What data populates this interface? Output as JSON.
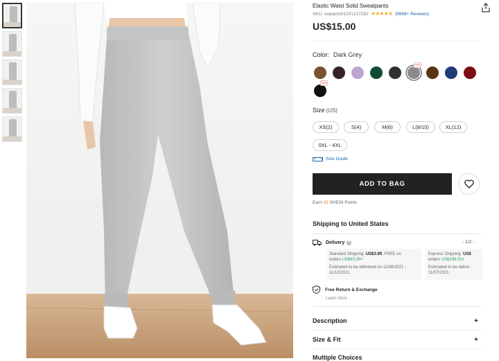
{
  "product": {
    "title": "Elastic Waist Solid Sweatpants",
    "sku": "SKU: swpants01201217292",
    "stars": "★★★★★",
    "reviews": "(9999+ Reviews)",
    "price": "US$15.00"
  },
  "color": {
    "label": "Color:",
    "selected": "Dark Grey",
    "swatches": [
      {
        "name": "brown",
        "hex": "#7a5230"
      },
      {
        "name": "dark-burgundy",
        "hex": "#3a2328"
      },
      {
        "name": "lilac",
        "hex": "#bba5cf"
      },
      {
        "name": "dark-green",
        "hex": "#0f4d33"
      },
      {
        "name": "charcoal",
        "hex": "#2f3033"
      },
      {
        "name": "dark-grey",
        "hex": "#8a8a8a",
        "selected": true,
        "badge": "Hot"
      },
      {
        "name": "coffee",
        "hex": "#5a3614"
      },
      {
        "name": "navy",
        "hex": "#1f3b7a"
      },
      {
        "name": "burgundy",
        "hex": "#7a0f14"
      },
      {
        "name": "black",
        "hex": "#111111",
        "badge": "Hot"
      }
    ]
  },
  "size": {
    "label": "Size",
    "unit": "(US)",
    "options": [
      "XS(2)",
      "S(4)",
      "M(6)",
      "L(8/10)",
      "XL(12)",
      "0XL - 4XL"
    ],
    "guide": "Size Guide"
  },
  "actions": {
    "add_to_bag": "ADD TO BAG"
  },
  "points": {
    "prefix": "Earn",
    "value": "15",
    "suffix": "SHEIN Points"
  },
  "shipping": {
    "heading": "Shipping to United States",
    "delivery_label": "Delivery",
    "pager": "1/2",
    "standard": {
      "title_prefix": "Standard Shipping:",
      "price": "US$3.99",
      "free_on": ", FREE on",
      "orders": "orders",
      "threshold": "US$40.00+",
      "estimate": "Estimated to be delivered on 11/08/2021 - 11/10/2021."
    },
    "express": {
      "title_prefix": "Express Shipping:",
      "price": "US$",
      "free_on": "",
      "orders": "orders",
      "threshold": "US$199.00+",
      "estimate": "Estimated to be delive - 11/07/2021."
    },
    "free_return": "Free Return & Exchange",
    "learn_more": "Learn More"
  },
  "accordion": {
    "description": "Description",
    "size_fit": "Size & Fit",
    "multiple_choices": "Multiple Choices",
    "plus": "+"
  },
  "icons": {
    "share": "share-icon",
    "heart": "heart-icon",
    "truck": "truck-icon",
    "shield": "shield-icon",
    "ruler": "ruler-icon"
  }
}
